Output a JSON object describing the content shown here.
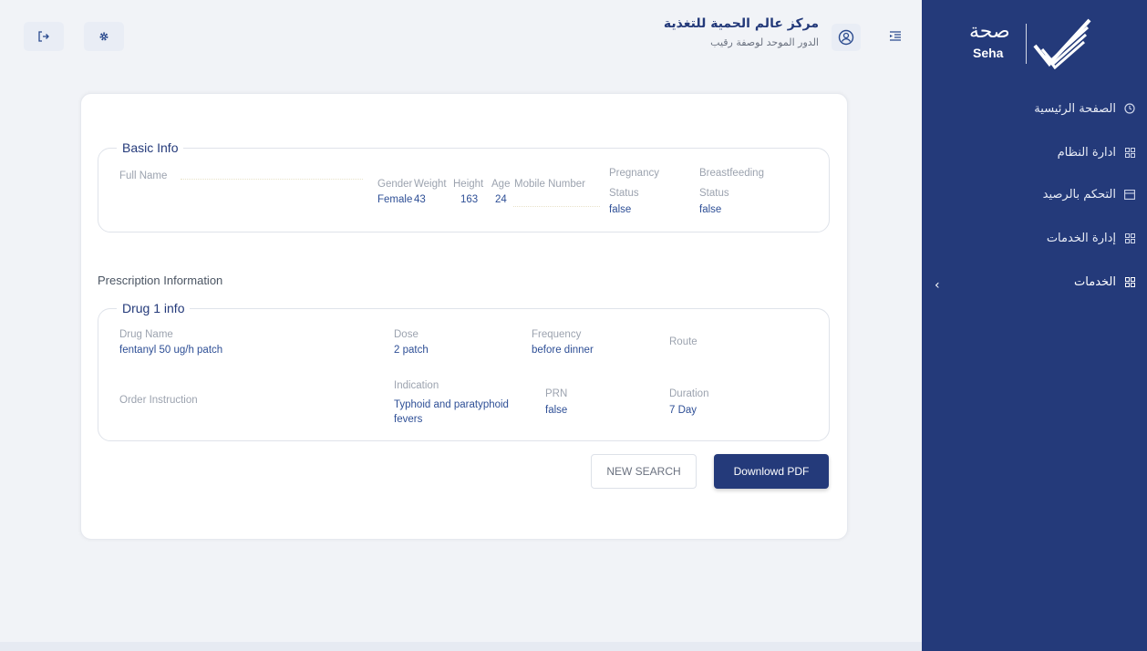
{
  "sidebar": {
    "logo_ar": "صحة",
    "logo_en": "Seha",
    "items": [
      {
        "label": "الصفحة الرئيسية",
        "icon": "clock-icon"
      },
      {
        "label": "ادارة النظام",
        "icon": "grid-icon"
      },
      {
        "label": "التحكم بالرصيد",
        "icon": "wallet-icon"
      },
      {
        "label": "إدارة الخدمات",
        "icon": "grid-icon"
      },
      {
        "label": "الخدمات",
        "icon": "grid-icon"
      }
    ],
    "chevron": "‹"
  },
  "header": {
    "org_title": "مركز عالم الحمية للتغذية",
    "org_subtitle": "الدور الموحد لوصفة رقيب",
    "logout_icon": "logout-icon",
    "settings_icon": "gear-icon"
  },
  "basic_info": {
    "legend": "Basic Info",
    "full_name_label": "Full Name",
    "full_name_value": "",
    "gender_label": "Gender",
    "gender_value": "Female",
    "weight_label": "Weight",
    "weight_value": "43",
    "height_label": "Height",
    "height_value": "163",
    "age_label": "Age",
    "age_value": "24",
    "mobile_label": "Mobile Number",
    "mobile_value": "",
    "pregnancy_label_1": "Pregnancy",
    "pregnancy_label_2": "Status",
    "pregnancy_value": "false",
    "breastfeeding_label_1": "Breastfeeding",
    "breastfeeding_label_2": "Status",
    "breastfeeding_value": "false"
  },
  "prescription": {
    "section_title": "Prescription Information",
    "drug_legend": "Drug 1 info",
    "drug_name_label": "Drug Name",
    "drug_name_value": "fentanyl 50 ug/h patch",
    "dose_label": "Dose",
    "dose_value": "2 patch",
    "frequency_label": "Frequency",
    "frequency_value": "before dinner",
    "route_label": "Route",
    "route_value": "",
    "order_instruction_label": "Order Instruction",
    "order_instruction_value": "",
    "indication_label": "Indication",
    "indication_value_1": "Typhoid and paratyphoid",
    "indication_value_2": "fevers",
    "prn_label": "PRN",
    "prn_value": "false",
    "duration_label": "Duration",
    "duration_value": "7 Day"
  },
  "actions": {
    "new_search": "NEW SEARCH",
    "download_pdf": "Downlowd PDF"
  },
  "colors": {
    "sidebar": "#243a7a",
    "primary": "#243a7a",
    "value_text": "#2e4f96",
    "background": "#f1f3f7"
  }
}
